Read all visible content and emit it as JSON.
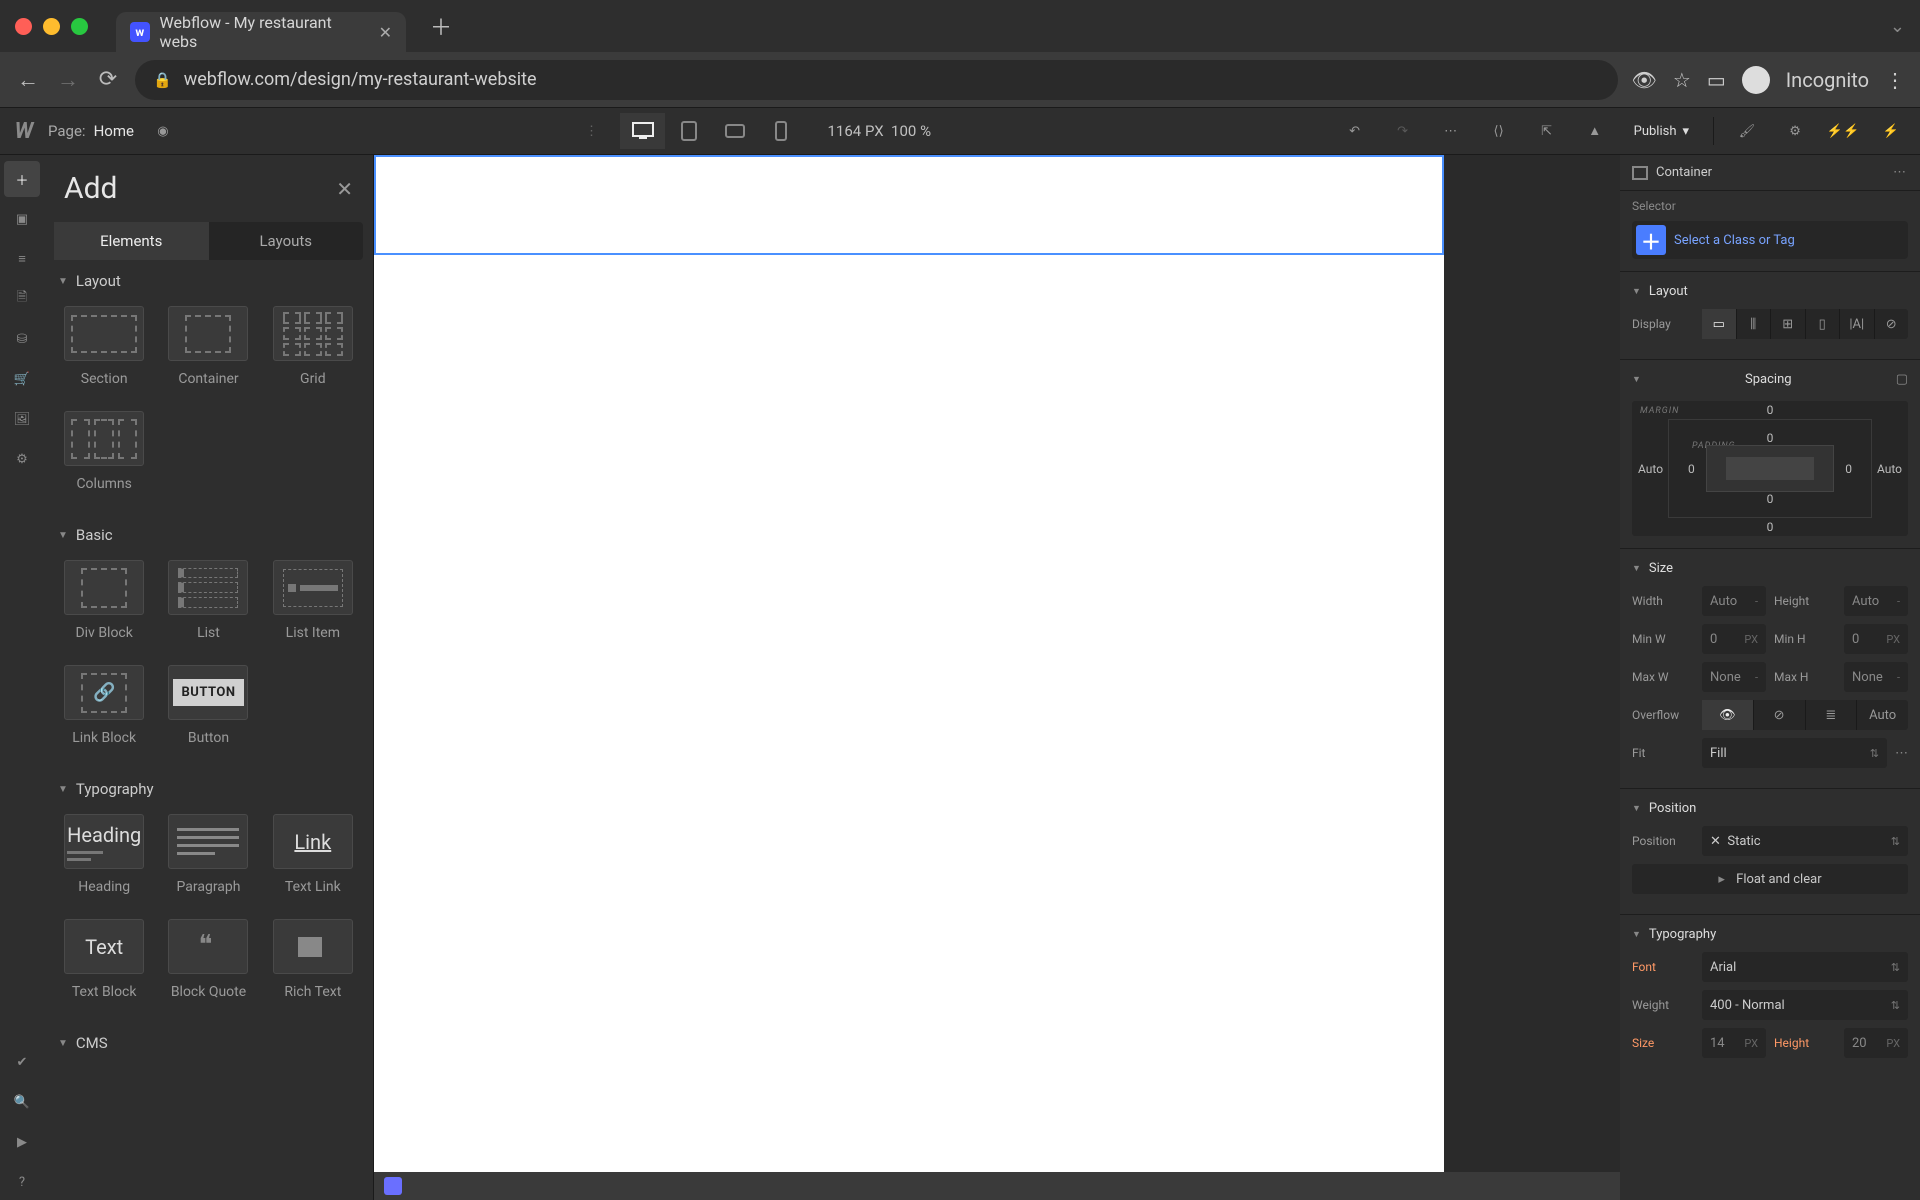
{
  "browser": {
    "tab_title": "Webflow - My restaurant webs",
    "url": "webflow.com/design/my-restaurant-website",
    "mode": "Incognito"
  },
  "toolbar": {
    "page_prefix": "Page:",
    "page_name": "Home",
    "viewport_px": "1164",
    "px_label": "PX",
    "zoom": "100",
    "zoom_unit": "%",
    "publish": "Publish"
  },
  "left_panel": {
    "title": "Add",
    "tabs": {
      "elements": "Elements",
      "layouts": "Layouts"
    },
    "sections": {
      "layout": {
        "title": "Layout",
        "items": [
          "Section",
          "Container",
          "Grid",
          "Columns"
        ]
      },
      "basic": {
        "title": "Basic",
        "items": [
          "Div Block",
          "List",
          "List Item",
          "Link Block",
          "Button"
        ]
      },
      "typography": {
        "title": "Typography",
        "items": [
          "Heading",
          "Paragraph",
          "Text Link",
          "Text Block",
          "Block Quote",
          "Rich Text"
        ]
      },
      "cms": {
        "title": "CMS"
      }
    },
    "button_thumb": "BUTTON",
    "heading_thumb": "Heading",
    "link_thumb": "Link",
    "text_thumb": "Text"
  },
  "right_panel": {
    "breadcrumb": "Container",
    "selector_label": "Selector",
    "selector_placeholder": "Select a Class or Tag",
    "layout": {
      "title": "Layout",
      "display_label": "Display"
    },
    "spacing": {
      "title": "Spacing",
      "margin_label": "MARGIN",
      "padding_label": "PADDING",
      "m_top": "0",
      "m_bottom": "0",
      "m_left": "Auto",
      "m_right": "Auto",
      "p_top": "0",
      "p_right": "0",
      "p_bottom": "0",
      "p_left": "0"
    },
    "size": {
      "title": "Size",
      "width": "Width",
      "height": "Height",
      "minw": "Min W",
      "minh": "Min H",
      "maxw": "Max W",
      "maxh": "Max H",
      "overflow": "Overflow",
      "fit": "Fit",
      "auto": "Auto",
      "none": "None",
      "zero": "0",
      "px": "PX",
      "dash": "-",
      "fill": "Fill",
      "auto_btn": "Auto"
    },
    "position": {
      "title": "Position",
      "label": "Position",
      "static": "Static",
      "float": "Float and clear"
    },
    "typography": {
      "title": "Typography",
      "font_label": "Font",
      "font": "Arial",
      "weight_label": "Weight",
      "weight": "400 - Normal",
      "size_label": "Size",
      "size": "14",
      "size_unit": "PX",
      "height_label": "Height",
      "height": "20",
      "height_unit": "PX"
    }
  }
}
